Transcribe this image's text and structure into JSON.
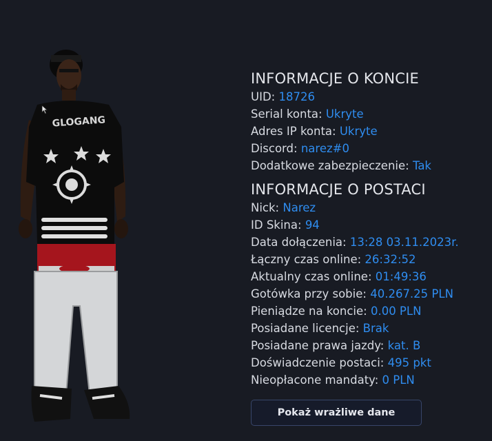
{
  "account": {
    "title": "INFORMACJE O KONCIE",
    "rows": [
      {
        "label": "UID: ",
        "value": "18726"
      },
      {
        "label": "Serial konta: ",
        "value": "Ukryte"
      },
      {
        "label": "Adres IP konta: ",
        "value": "Ukryte"
      },
      {
        "label": "Discord: ",
        "value": "narez#0"
      },
      {
        "label": "Dodatkowe zabezpieczenie: ",
        "value": "Tak"
      }
    ]
  },
  "character": {
    "title": "INFORMACJE O POSTACI",
    "rows": [
      {
        "label": "Nick: ",
        "value": "Narez"
      },
      {
        "label": "ID Skina: ",
        "value": "94"
      },
      {
        "label": "Data dołączenia: ",
        "value": "13:28 03.11.2023r."
      },
      {
        "label": "Łączny czas online: ",
        "value": "26:32:52"
      },
      {
        "label": "Aktualny czas online: ",
        "value": "01:49:36"
      },
      {
        "label": "Gotówka przy sobie: ",
        "value": "40.267.25 PLN"
      },
      {
        "label": "Pieniądze na koncie: ",
        "value": "0.00 PLN"
      },
      {
        "label": "Posiadane licencje: ",
        "value": "Brak"
      },
      {
        "label": "Posiadane prawa jazdy: ",
        "value": "kat. B"
      },
      {
        "label": "Doświadczenie postaci: ",
        "value": "495 pkt"
      },
      {
        "label": "Nieopłacone mandaty: ",
        "value": "0 PLN"
      }
    ]
  },
  "button": {
    "label": "Pokaż wrażliwe dane"
  },
  "preview": {
    "shirt_text": "GLOGANG"
  },
  "colors": {
    "background": "#181b23",
    "value": "#2f8df0",
    "text": "#d8dbe2"
  }
}
